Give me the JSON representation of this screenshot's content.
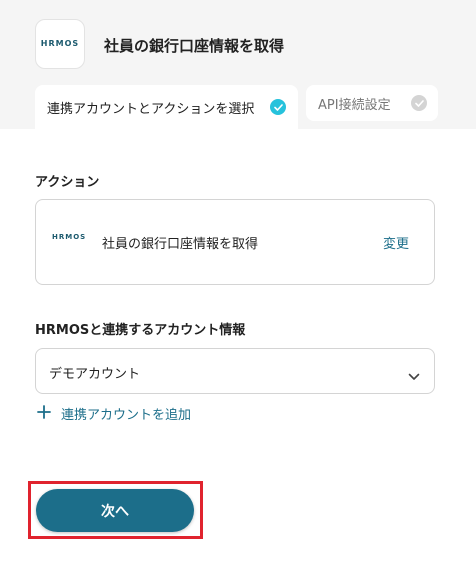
{
  "header": {
    "logo": {
      "name": "HRMOS",
      "sub": ""
    },
    "title": "社員の銀行口座情報を取得"
  },
  "tabs": [
    {
      "label": "連携アカウントとアクションを選択",
      "state": "active",
      "check_color": "#26c2dc"
    },
    {
      "label": "API接続設定",
      "state": "inactive",
      "check_color": "#d4d4d4"
    }
  ],
  "action_section": {
    "label": "アクション",
    "card_logo": "HRMOS",
    "action_name": "社員の銀行口座情報を取得",
    "change_label": "変更"
  },
  "account_section": {
    "label": "HRMOSと連携するアカウント情報",
    "selected_account": "デモアカウント",
    "add_account_label": "連携アカウントを追加"
  },
  "footer": {
    "next_label": "次へ"
  },
  "colors": {
    "accent": "#1c6e8a",
    "highlight": "#e0232e"
  }
}
